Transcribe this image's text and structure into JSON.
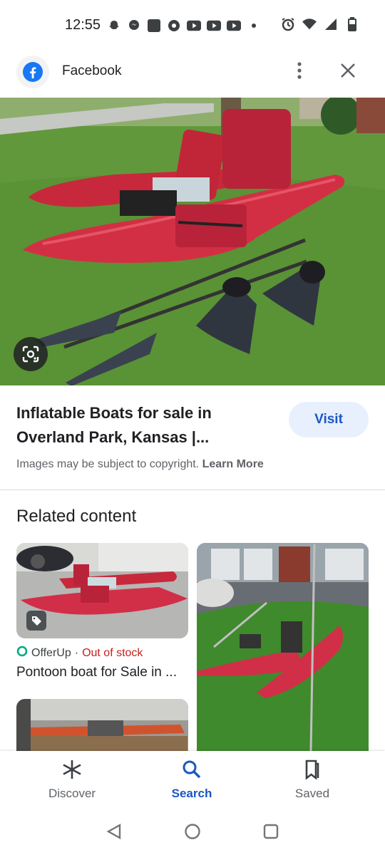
{
  "status_bar": {
    "time": "12:55",
    "left_icons": [
      "snapchat-icon",
      "messenger-icon",
      "app-icon",
      "threads-icon",
      "youtube-icon",
      "youtube-icon",
      "youtube-icon",
      "dot-icon"
    ],
    "right_icons": [
      "alarm-icon",
      "wifi-icon",
      "signal-icon",
      "battery-icon"
    ]
  },
  "header": {
    "site_name": "Facebook",
    "site_icon": "facebook-logo-icon",
    "menu_icon": "more-vert-icon",
    "close_icon": "close-icon"
  },
  "hero": {
    "lens_icon": "google-lens-icon"
  },
  "result": {
    "title": "Inflatable Boats for sale in Overland Park, Kansas |...",
    "visit_label": "Visit",
    "copyright_text": "Images may be subject to copyright.",
    "learn_more": "Learn More"
  },
  "related": {
    "heading": "Related content",
    "card1": {
      "source": "OfferUp",
      "separator": "·",
      "stock": "Out of stock",
      "title": "Pontoon boat for Sale in ..."
    }
  },
  "bottom_nav": {
    "items": [
      {
        "label": "Discover",
        "icon": "asterisk-icon"
      },
      {
        "label": "Search",
        "icon": "search-icon"
      },
      {
        "label": "Saved",
        "icon": "bookmark-icon"
      }
    ]
  },
  "colors": {
    "accent": "#1a56c5",
    "boat_red": "#c8283c",
    "out_of_stock": "#c5221f",
    "grass": "#5f9a3a"
  }
}
